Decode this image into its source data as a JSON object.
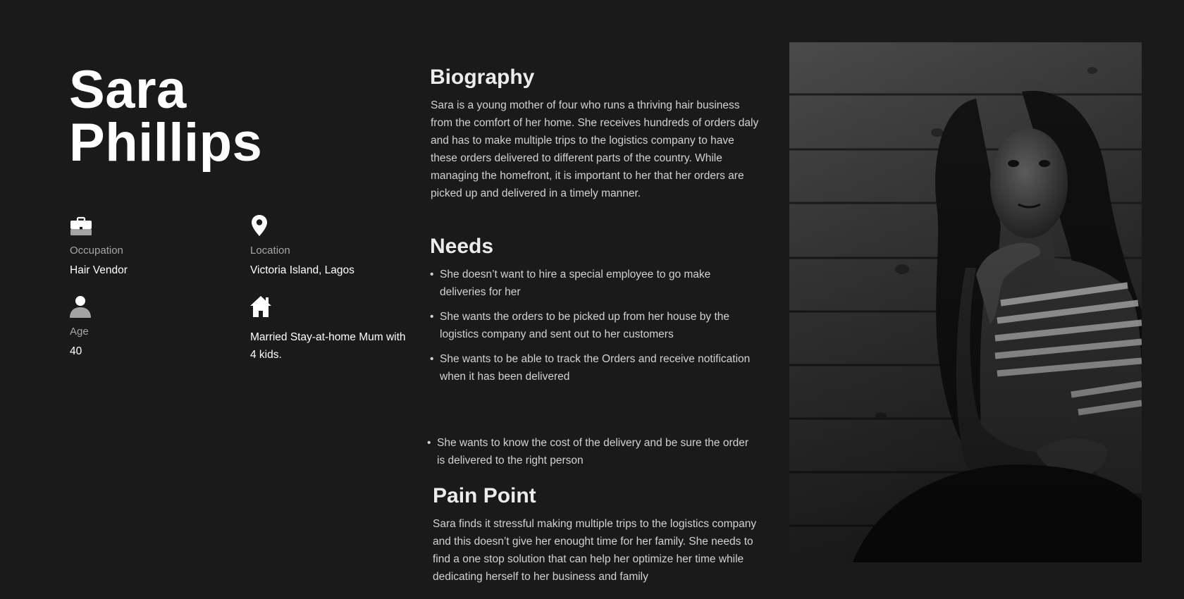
{
  "persona": {
    "first_name": "Sara",
    "last_name": "Phillips"
  },
  "attributes": {
    "occupation": {
      "icon": "briefcase-icon",
      "label": "Occupation",
      "value": "Hair Vendor"
    },
    "location": {
      "icon": "map-pin-icon",
      "label": "Location",
      "value": "Victoria Island, Lagos"
    },
    "age": {
      "icon": "person-icon",
      "label": "Age",
      "value": "40"
    },
    "family": {
      "icon": "home-icon",
      "value": "Married Stay-at-home Mum with 4 kids."
    }
  },
  "biography": {
    "title": "Biography",
    "text": "Sara is a young mother of four who runs a thriving hair business from the comfort of her home. She receives hundreds of orders daly and has to make multiple trips to the logistics company to have these orders delivered to different  parts of the country. While managing the homefront, it is important to her that her orders are picked up and delivered in a timely manner."
  },
  "needs": {
    "title": "Needs",
    "bullet": "•",
    "items": [
      "She doesn’t want to hire a special employee to go make deliveries for her",
      "She wants the orders to be picked up from her house by the logistics company and sent out to her customers",
      "She wants to be able to track the Orders  and receive notification when it has been delivered",
      "She wants to know the cost of the delivery and be sure the order is delivered to the right person"
    ]
  },
  "pain_point": {
    "title": "Pain Point",
    "text": "Sara finds it stressful making multiple trips to the logistics company and this doesn’t give her enought time for her family. She needs to find a one stop solution that can help her optimize her time while dedicating herself to her business and family"
  },
  "colors": {
    "background": "#1a1a1b",
    "heading": "#ffffff",
    "body_text": "#d2d2d2",
    "label_text": "#a6a6a6"
  }
}
